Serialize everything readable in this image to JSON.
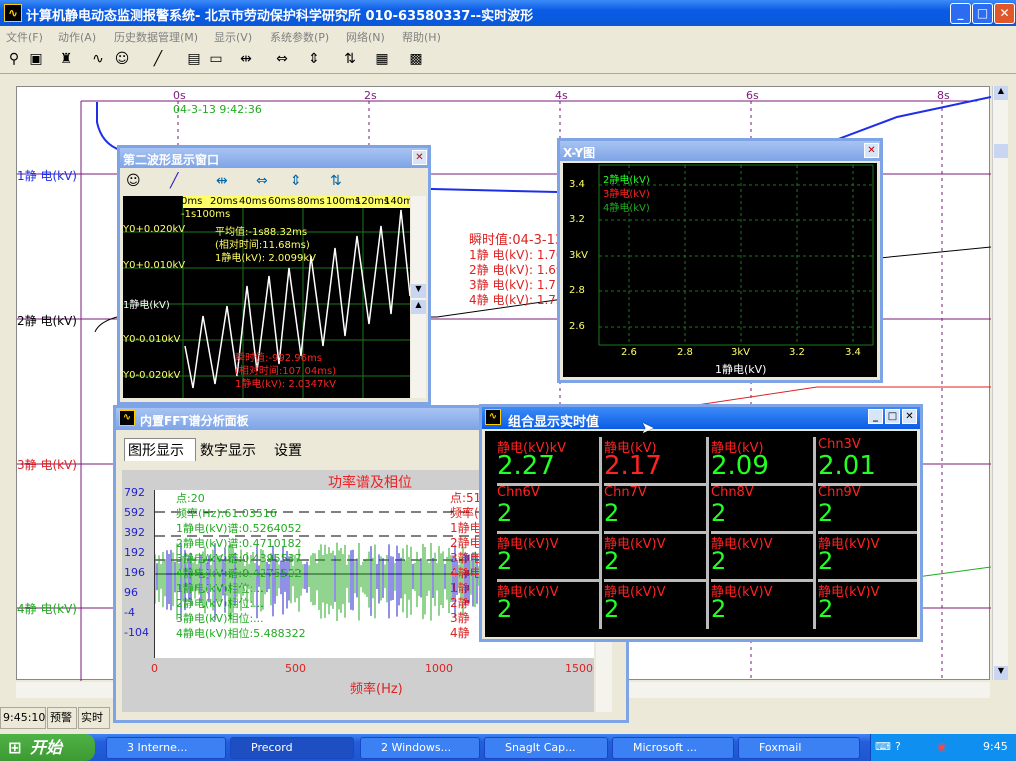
{
  "app": {
    "title": "计算机静电动态监测报警系统- 北京市劳动保护科学研究所  010-63580337--实时波形"
  },
  "menu": [
    "文件(F)",
    "动作(A)",
    "历史数据管理(M)",
    "显示(V)",
    "系统参数(P)",
    "网络(N)",
    "帮助(H)"
  ],
  "toolbar_icons": [
    "binoculars-icon",
    "monitor-icon",
    "siren-icon",
    "waveform-icon",
    "smiley-icon",
    "pen-icon",
    "save-icon",
    "folder-icon",
    "expand-h-icon",
    "shrink-h-icon",
    "expand-v-icon",
    "shrink-v-icon",
    "chart-icon",
    "grid-icon"
  ],
  "main": {
    "time_ticks": [
      "0s",
      "2s",
      "4s",
      "6s",
      "8s"
    ],
    "start_time": "04-3-13 9:42:36",
    "channels": [
      "1静 电(kV)",
      "2静 电(kV)",
      "3静 电(kV)",
      "4静 电(kV)"
    ],
    "readout": {
      "title": "瞬时值:04-3-13",
      "lines": [
        "1静 电(kV): 1.70",
        "2静 电(kV): 1.69",
        "3静 电(kV): 1.71",
        "4静 电(kV): 1.73"
      ]
    }
  },
  "wave2": {
    "title": "第二波形显示窗口",
    "time_ticks": [
      "0ms",
      "20ms",
      "40ms",
      "60ms",
      "80ms",
      "100ms",
      "120ms",
      "140m"
    ],
    "offset": "-1s100ms",
    "yticks": [
      "Y0+0.020kV",
      "Y0+0.010kV",
      "1静电(kV)",
      "Y0-0.010kV",
      "Y0-0.020kV"
    ],
    "avg": [
      "平均值:-1s88.32ms",
      "(相对时间:11.68ms)",
      "1静电(kV): 2.0099kV"
    ],
    "inst": [
      "瞬时值:-992.96ms",
      "(相对时间:107.04ms)",
      "1静电(kV): 2.0347kV"
    ]
  },
  "xy": {
    "title": "X-Y图",
    "yticks": [
      "3.4",
      "3.2",
      "3kV",
      "2.8",
      "2.6"
    ],
    "xticks": [
      "2.6",
      "2.8",
      "3kV",
      "3.2",
      "3.4"
    ],
    "xlabel": "1静电(kV)",
    "legend": [
      "2静电(kV)",
      "3静电(kV)",
      "4静电(kV)"
    ]
  },
  "fft": {
    "title": "内置FFT谱分析面板",
    "tabs": [
      "图形显示",
      "数字显示",
      "设置"
    ],
    "chart_title": "功率谱及相位",
    "yticks": [
      "792",
      "592",
      "392",
      "192",
      "196",
      "96",
      "-4",
      "-104"
    ],
    "xticks": [
      "0",
      "500",
      "1000",
      "1500"
    ],
    "xlabel": "频率(Hz)",
    "left": [
      "点:20",
      "频率(Hz):61.03516",
      "1静电(kV)谱:0.5264052",
      "2静电(kV)谱:0.4710182",
      "3静电(kV)谱:0.4395537",
      "4静电(kV)谱:0.4275502",
      "1静电(kV)相位:...",
      "2静电(kV)相位:...",
      "3静电(kV)相位:...",
      "4静电(kV)相位:5.488322"
    ],
    "right": [
      "点:512",
      "频率(",
      "1静电(",
      "2静电(",
      "3静电(",
      "4静电(",
      "1静",
      "2静",
      "3静",
      "4静"
    ]
  },
  "combo": {
    "title": "组合显示实时值",
    "cells": [
      {
        "name": "静电(kV)kV",
        "value": "2.27",
        "hi": true
      },
      {
        "name": "静电(kV)",
        "value": "2.17",
        "hi": false
      },
      {
        "name": "静电(kV)",
        "value": "2.09",
        "hi": true
      },
      {
        "name": "Chn3V",
        "value": "2.01",
        "hi": true
      },
      {
        "name": "Chn6V",
        "value": "2",
        "hi": true
      },
      {
        "name": "Chn7V",
        "value": "2",
        "hi": true
      },
      {
        "name": "Chn8V",
        "value": "2",
        "hi": true
      },
      {
        "name": "Chn9V",
        "value": "2",
        "hi": true
      },
      {
        "name": "静电(kV)V",
        "value": "2",
        "hi": true
      },
      {
        "name": "静电(kV)V",
        "value": "2",
        "hi": true
      },
      {
        "name": "静电(kV)V",
        "value": "2",
        "hi": true
      },
      {
        "name": "静电(kV)V",
        "value": "2",
        "hi": true
      },
      {
        "name": "静电(kV)V",
        "value": "2",
        "hi": true
      },
      {
        "name": "静电(kV)V",
        "value": "2",
        "hi": true
      },
      {
        "name": "静电(kV)V",
        "value": "2",
        "hi": true
      },
      {
        "name": "静电(kV)V",
        "value": "2",
        "hi": true
      }
    ]
  },
  "status": {
    "time": "9:45:10",
    "alarm": "预警",
    "mode": "实时"
  },
  "taskbar": {
    "start": "开始",
    "tasks": [
      "3 Interne...",
      "Precord",
      "2 Windows...",
      "SnagIt Cap...",
      "Microsoft ...",
      "Foxmail"
    ],
    "clock": "9:45"
  }
}
